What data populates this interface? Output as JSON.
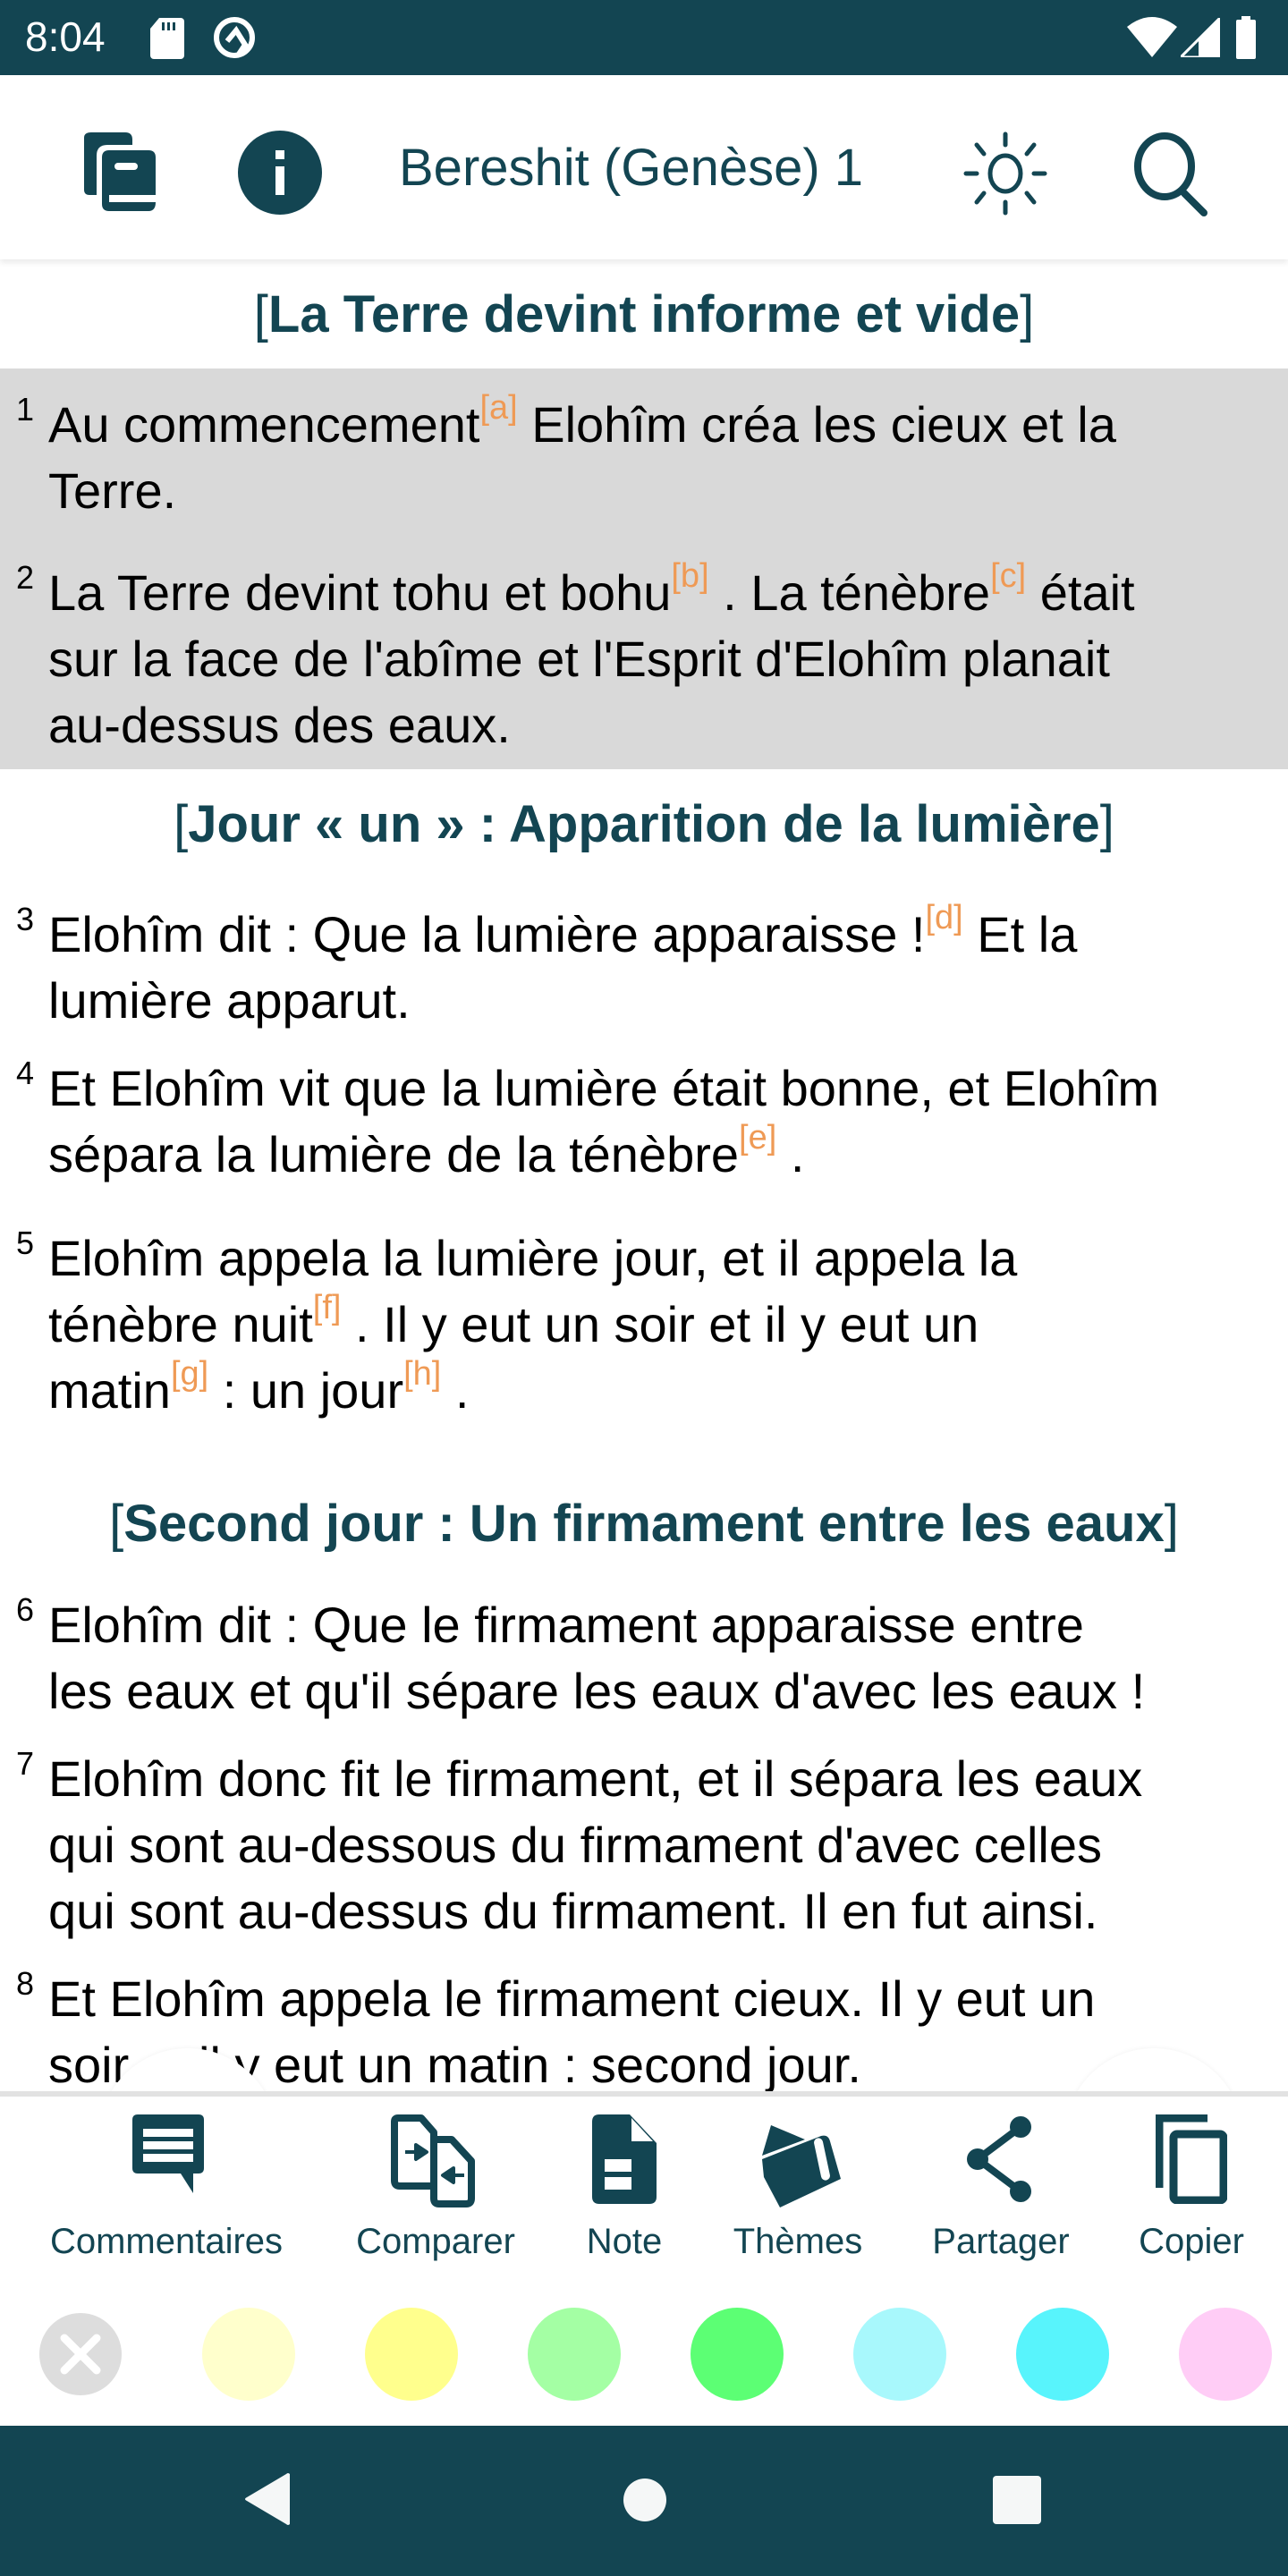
{
  "status_bar": {
    "time": "8:04",
    "icons": [
      "sd-card-icon",
      "sync-q-icon",
      "wifi-icon",
      "signal-icon",
      "battery-icon"
    ]
  },
  "app_bar": {
    "title": "Bereshit (Genèse) 1",
    "left_icons": [
      "books-icon",
      "info-icon"
    ],
    "right_icons": [
      "brightness-icon",
      "search-icon"
    ]
  },
  "colors": {
    "primary": "#134552",
    "footnote": "#ef9a55",
    "highlight": "#d9d9d9"
  },
  "content": {
    "sections": [
      {
        "title": "La Terre devint informe et vide"
      },
      {
        "title": "Jour « un » : Apparition de la lumière"
      },
      {
        "title": "Second jour : Un firmament entre les eaux"
      }
    ],
    "verses": [
      {
        "num": "1",
        "selected": true,
        "lines": [
          [
            {
              "t": "Au commencement"
            },
            {
              "fn": "[a]"
            },
            {
              "t": " Elohîm créa les cieux et la"
            }
          ],
          [
            {
              "t": "Terre."
            }
          ]
        ]
      },
      {
        "num": "2",
        "selected": true,
        "lines": [
          [
            {
              "t": "La Terre devint tohu et bohu"
            },
            {
              "fn": "[b]"
            },
            {
              "t": " . La ténèbre"
            },
            {
              "fn": "[c]"
            },
            {
              "t": " était"
            }
          ],
          [
            {
              "t": "sur la face de l'abîme et l'Esprit d'Elohîm planait"
            }
          ],
          [
            {
              "t": "au-dessus des eaux."
            }
          ]
        ]
      },
      {
        "num": "3",
        "selected": false,
        "lines": [
          [
            {
              "t": "Elohîm dit : Que la lumière apparaisse !"
            },
            {
              "fn": "[d]"
            },
            {
              "t": " Et la"
            }
          ],
          [
            {
              "t": "lumière apparut."
            }
          ]
        ]
      },
      {
        "num": "4",
        "selected": false,
        "lines": [
          [
            {
              "t": "Et Elohîm vit que la lumière était bonne, et Elohîm"
            }
          ],
          [
            {
              "t": "sépara la lumière de la ténèbre"
            },
            {
              "fn": "[e]"
            },
            {
              "t": " ."
            }
          ]
        ]
      },
      {
        "num": "5",
        "selected": false,
        "lines": [
          [
            {
              "t": "Elohîm appela la lumière jour, et il appela la"
            }
          ],
          [
            {
              "t": "ténèbre nuit"
            },
            {
              "fn": "[f]"
            },
            {
              "t": " . Il y eut un soir et il y eut un"
            }
          ],
          [
            {
              "t": "matin"
            },
            {
              "fn": "[g]"
            },
            {
              "t": " : un jour"
            },
            {
              "fn": "[h]"
            },
            {
              "t": " ."
            }
          ]
        ]
      },
      {
        "num": "6",
        "selected": false,
        "lines": [
          [
            {
              "t": "Elohîm dit : Que le firmament apparaisse entre"
            }
          ],
          [
            {
              "t": "les eaux et qu'il sépare les eaux d'avec les eaux !"
            }
          ]
        ]
      },
      {
        "num": "7",
        "selected": false,
        "lines": [
          [
            {
              "t": "Elohîm donc fit le firmament, et il sépara les eaux"
            }
          ],
          [
            {
              "t": "qui sont au-dessous du firmament d'avec celles"
            }
          ],
          [
            {
              "t": "qui sont au-dessus du firmament. Il en fut ainsi."
            }
          ]
        ]
      },
      {
        "num": "8",
        "selected": false,
        "lines": [
          [
            {
              "t": "Et Elohîm appela le firmament cieux. Il y eut un"
            }
          ],
          [
            {
              "t": "soir et il y eut un matin : second jour."
            }
          ]
        ]
      }
    ]
  },
  "actions": [
    {
      "label": "Commentaires",
      "icon": "comment-icon"
    },
    {
      "label": "Comparer",
      "icon": "compare-icon"
    },
    {
      "label": "Note",
      "icon": "note-icon"
    },
    {
      "label": "Thèmes",
      "icon": "themes-icon"
    },
    {
      "label": "Partager",
      "icon": "share-icon"
    },
    {
      "label": "Copier",
      "icon": "copy-icon"
    }
  ],
  "highlight_colors": [
    {
      "name": "clear",
      "color": "#dddddd"
    },
    {
      "name": "light-yellow",
      "color": "#ffffcc"
    },
    {
      "name": "yellow",
      "color": "#ffff8d"
    },
    {
      "name": "light-green",
      "color": "#a4ffa4"
    },
    {
      "name": "green",
      "color": "#5cff74"
    },
    {
      "name": "light-cyan",
      "color": "#a8f8fc"
    },
    {
      "name": "cyan",
      "color": "#58f4fc"
    },
    {
      "name": "pink",
      "color": "#ffcdf6"
    }
  ],
  "nav_bar": {
    "buttons": [
      "back-icon",
      "home-icon",
      "recents-icon"
    ]
  }
}
